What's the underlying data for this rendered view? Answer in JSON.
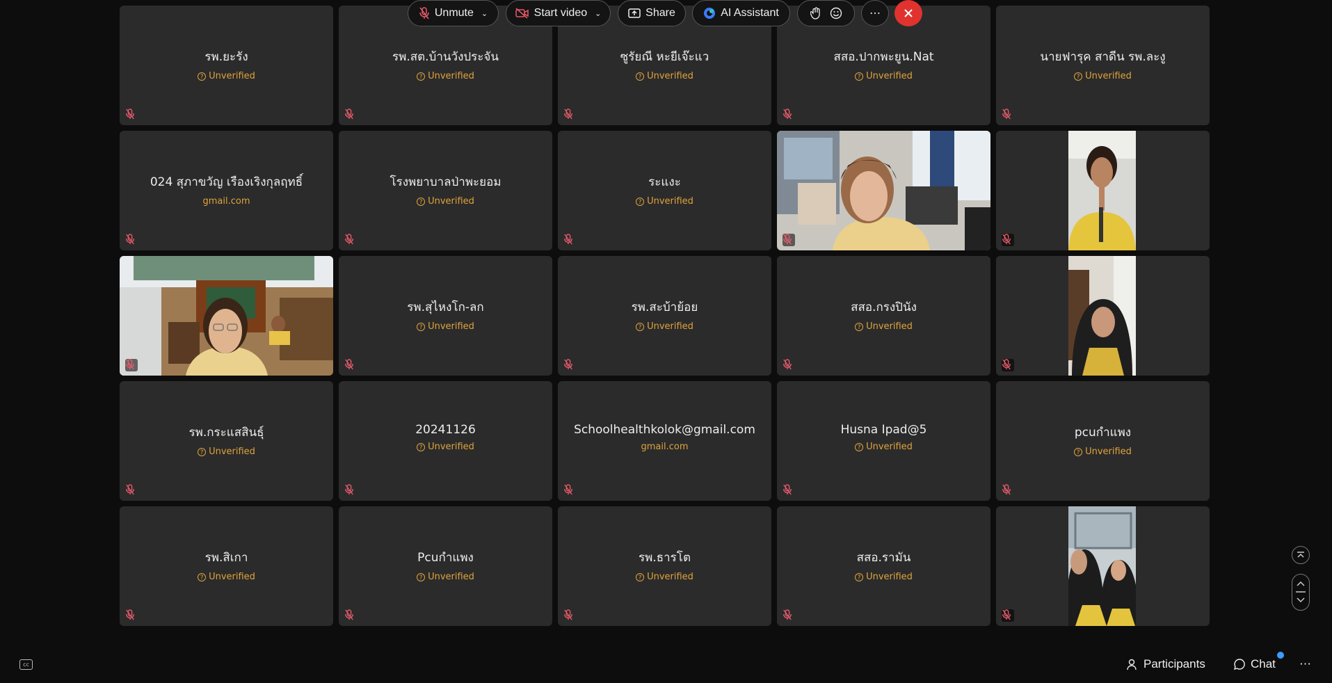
{
  "participants": [
    {
      "name": "รพ.ยะรัง",
      "status": "Unverified",
      "icon": "warning"
    },
    {
      "name": "รพ.สต.บ้านวังประจัน",
      "status": "Unverified",
      "icon": "warning"
    },
    {
      "name": "ซูรัยณี หะยีเจ๊ะแว",
      "status": "Unverified",
      "icon": "warning"
    },
    {
      "name": "สสอ.ปากพะยูน.Nat",
      "status": "Unverified",
      "icon": "warning"
    },
    {
      "name": "นายฟารุค สาดีน รพ.ละงู",
      "status": "Unverified",
      "icon": "warning"
    },
    {
      "name": "024 สุภาขวัญ เรืองเริงกุลฤทธิ์",
      "status": "gmail.com",
      "icon": "none"
    },
    {
      "name": "โรงพยาบาลป่าพะยอม",
      "status": "Unverified",
      "icon": "warning"
    },
    {
      "name": "ระแงะ",
      "status": "Unverified",
      "icon": "warning"
    },
    {
      "video": "woman-office"
    },
    {
      "video": "woman-portrait-yellow"
    },
    {
      "video": "woman-glasses-office"
    },
    {
      "name": "รพ.สุไหงโก-ลก",
      "status": "Unverified",
      "icon": "warning"
    },
    {
      "name": "รพ.สะบ้าย้อย",
      "status": "Unverified",
      "icon": "warning"
    },
    {
      "name": "สสอ.กรงปินัง",
      "status": "Unverified",
      "icon": "warning"
    },
    {
      "video": "woman-hijab"
    },
    {
      "name": "รพ.กระแสสินธุ์",
      "status": "Unverified",
      "icon": "warning"
    },
    {
      "name": "20241126",
      "status": "Unverified",
      "icon": "warning"
    },
    {
      "name": "Schoolhealthkolok@gmail.com",
      "status": "gmail.com",
      "icon": "none"
    },
    {
      "name": "Husna Ipad@5",
      "status": "Unverified",
      "icon": "warning"
    },
    {
      "name": "pcuกำแพง",
      "status": "Unverified",
      "icon": "warning"
    },
    {
      "name": "รพ.สิเกา",
      "status": "Unverified",
      "icon": "warning"
    },
    {
      "name": "Pcuกำแพง",
      "status": "Unverified",
      "icon": "warning"
    },
    {
      "name": "รพ.ธารโต",
      "status": "Unverified",
      "icon": "warning"
    },
    {
      "name": "สสอ.รามัน",
      "status": "Unverified",
      "icon": "warning"
    },
    {
      "video": "two-women-selfie"
    }
  ],
  "toolbar": {
    "unmute": "Unmute",
    "start_video": "Start video",
    "share": "Share",
    "ai_assistant": "AI Assistant",
    "more": "⋯",
    "participants": "Participants",
    "chat": "Chat"
  },
  "colors": {
    "tile_bg": "#2b2b2b",
    "unverified": "#e0a33c",
    "muted_icon": "#e85a6a",
    "end_call": "#e0332f",
    "chat_dot": "#3b9cff"
  }
}
